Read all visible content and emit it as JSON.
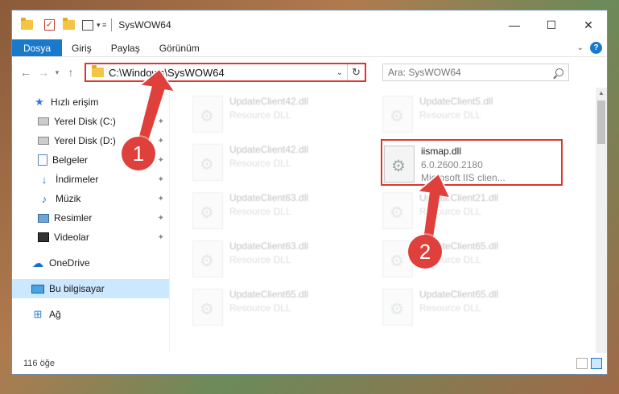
{
  "window": {
    "title": "SysWOW64",
    "controls": {
      "minimize": "—",
      "maximize": "☐",
      "close": "✕"
    }
  },
  "ribbon": {
    "tabs": [
      "Dosya",
      "Giriş",
      "Paylaş",
      "Görünüm"
    ],
    "help": "?"
  },
  "address": {
    "path": "C:\\Windows\\SysWOW64",
    "search_placeholder": "Ara: SysWOW64"
  },
  "sidebar": {
    "items": [
      {
        "label": "Hızlı erişim",
        "icon": "star-icon"
      },
      {
        "label": "Yerel Disk (C:)",
        "icon": "drive-icon",
        "pinned": true
      },
      {
        "label": "Yerel Disk (D:)",
        "icon": "drive-icon",
        "pinned": true
      },
      {
        "label": "Belgeler",
        "icon": "documents-icon",
        "pinned": true
      },
      {
        "label": "İndirmeler",
        "icon": "download-icon",
        "pinned": true
      },
      {
        "label": "Müzik",
        "icon": "music-icon",
        "pinned": true
      },
      {
        "label": "Resimler",
        "icon": "pictures-icon",
        "pinned": true
      },
      {
        "label": "Videolar",
        "icon": "videos-icon",
        "pinned": true
      },
      {
        "label": "OneDrive",
        "icon": "cloud-icon"
      },
      {
        "label": "Bu bilgisayar",
        "icon": "computer-icon",
        "selected": true
      },
      {
        "label": "Ağ",
        "icon": "network-icon"
      }
    ]
  },
  "files": [
    {
      "name": "UpdateClient42.dll",
      "desc": "Resource DLL"
    },
    {
      "name": "UpdateClient5.dll",
      "desc": "Resource DLL"
    },
    {
      "name": "UpdateClient42.dll",
      "desc": "Resource DLL"
    },
    {
      "name": "iismap.dll",
      "version": "6.0.2600.2180",
      "desc": "Microsoft IIS clien..."
    },
    {
      "name": "UpdateClient63.dll",
      "desc": "Resource DLL"
    },
    {
      "name": "UpdateClient21.dll",
      "desc": "Resource DLL"
    },
    {
      "name": "UpdateClient63.dll",
      "desc": "Resource DLL"
    },
    {
      "name": "UpdateClient65.dll",
      "desc": "Resource DLL"
    },
    {
      "name": "UpdateClient65.dll",
      "desc": "Resource DLL"
    },
    {
      "name": "UpdateClient65.dll",
      "desc": "Resource DLL"
    }
  ],
  "status": {
    "count": "116 öğe"
  },
  "annotations": {
    "step1": "1",
    "step2": "2",
    "color": "#e0403c"
  }
}
